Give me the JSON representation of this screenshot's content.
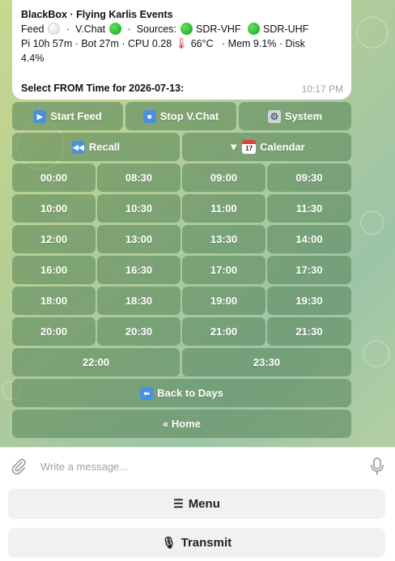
{
  "message": {
    "title": "BlackBox · Flying Karlis Events",
    "status_line1": {
      "feed_label": "Feed",
      "sep1": "·",
      "vchat_label": "V.Chat",
      "sep2": "·",
      "sources_label": "Sources:",
      "source1": "SDR-VHF",
      "source2": "SDR-UHF"
    },
    "status_line2": "Pi 10h 57m · Bot 27m   ·   CPU 0.28",
    "temp": "66°C",
    "status_line2b": "·   Mem 9.1% · Disk",
    "status_line3": "4.4%",
    "select_prompt": "Select FROM Time for 2026-07-13:",
    "time": "10:17 PM"
  },
  "keyboard": {
    "start_feed": "Start Feed",
    "stop_vchat": "Stop V.Chat",
    "system": "System",
    "recall": "Recall",
    "calendar": "Calendar",
    "times": [
      "00:00",
      "08:30",
      "09:00",
      "09:30",
      "10:00",
      "10:30",
      "11:00",
      "11:30",
      "12:00",
      "13:00",
      "13:30",
      "14:00",
      "16:00",
      "16:30",
      "17:00",
      "17:30",
      "18:00",
      "18:30",
      "19:00",
      "19:30",
      "20:00",
      "20:30",
      "21:00",
      "21:30"
    ],
    "times_wide": [
      "22:00",
      "23:30"
    ],
    "back_to_days": "Back to Days",
    "home": "« Home"
  },
  "input": {
    "placeholder": "Write a message..."
  },
  "reply_keyboard": {
    "menu": "Menu",
    "transmit": "Transmit"
  },
  "colors": {
    "button_bg": "rgba(84,130,86,0.55)",
    "status_green": "#1a9c1a",
    "timestamp": "#9aa3a9"
  }
}
